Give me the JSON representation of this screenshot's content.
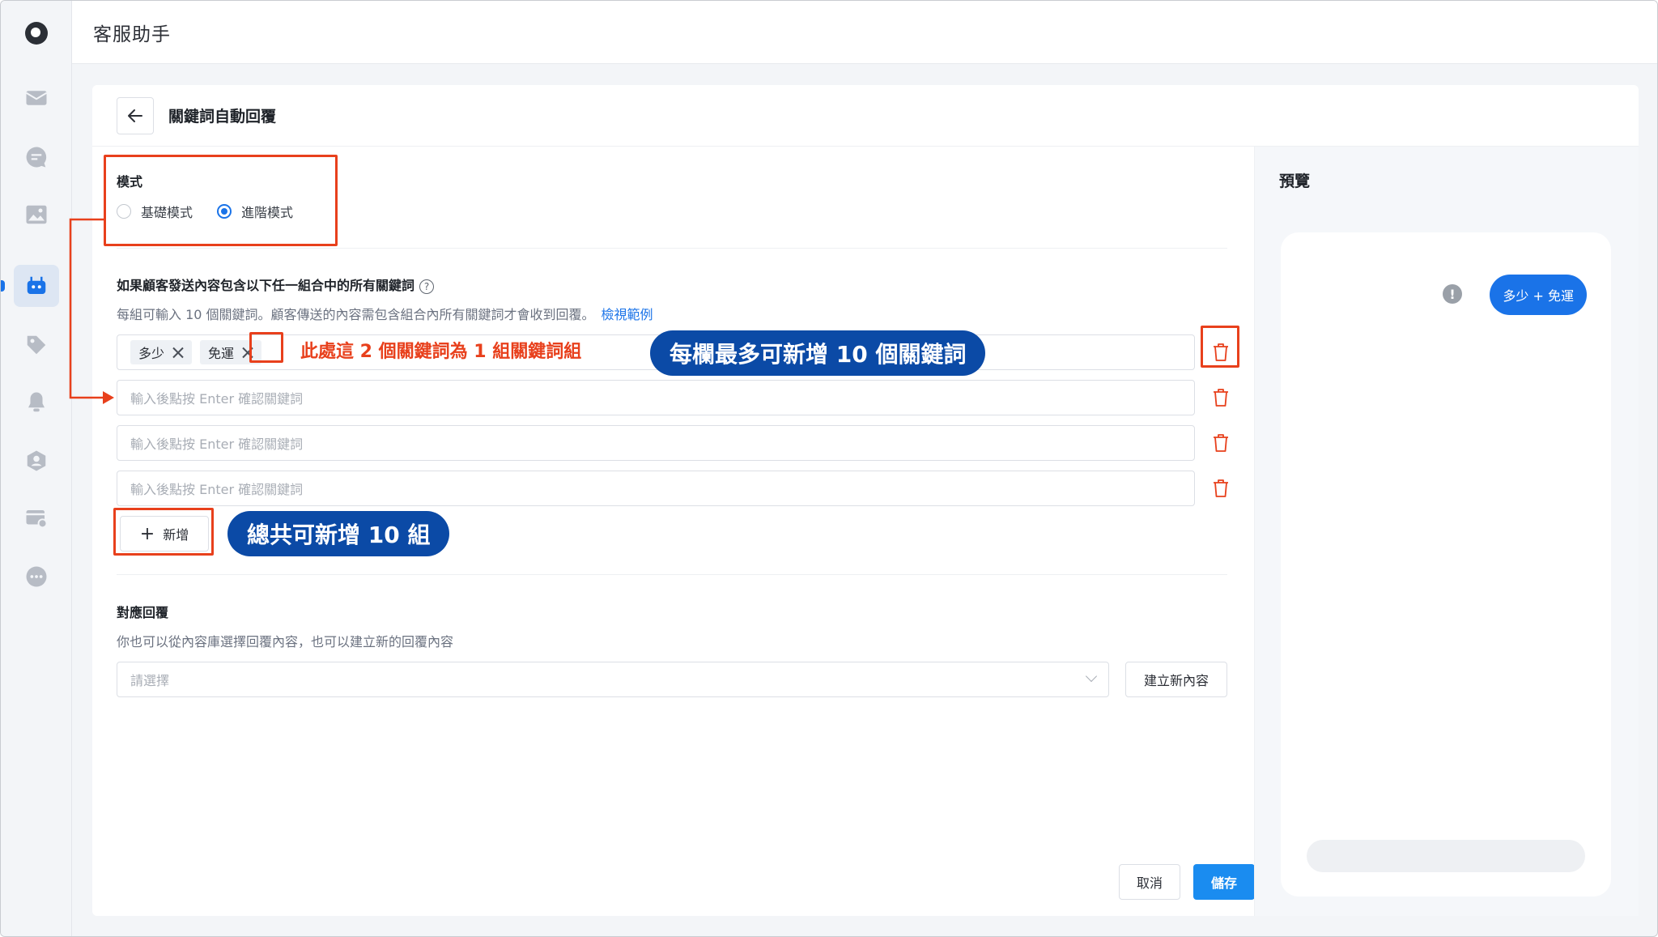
{
  "header": {
    "app_title": "客服助手"
  },
  "page": {
    "title": "關鍵詞自動回覆"
  },
  "mode": {
    "label": "模式",
    "options": [
      {
        "label": "基礎模式",
        "selected": false
      },
      {
        "label": "進階模式",
        "selected": true
      }
    ]
  },
  "keywords": {
    "title": "如果顧客發送內容包含以下任一組合中的所有關鍵詞",
    "hint": "每組可輸入 10 個關鍵詞。顧客傳送的內容需包含組合內所有關鍵詞才會收到回覆。",
    "example_link": "檢視範例",
    "placeholder": "輸入後點按 Enter 確認關鍵詞",
    "groups": [
      {
        "tags": [
          "多少",
          "免運"
        ]
      },
      {
        "tags": []
      },
      {
        "tags": []
      },
      {
        "tags": []
      }
    ],
    "add_label": "新增"
  },
  "reply": {
    "title": "對應回覆",
    "hint": "你也可以從內容庫選擇回覆內容，也可以建立新的回覆內容",
    "select_placeholder": "請選擇",
    "create_label": "建立新內容"
  },
  "footer": {
    "cancel_label": "取消",
    "save_label": "儲存"
  },
  "preview": {
    "title": "預覽",
    "bubble_text": "多少 + 免運",
    "warn_symbol": "!"
  },
  "annotations": {
    "group_note": "此處這 2 個關鍵詞為 1 組關鍵詞組",
    "per_row_note": "每欄最多可新增 10 個關鍵詞",
    "total_note": "總共可新增 10 組"
  },
  "colors": {
    "accent": "#1a73e8",
    "annotation_red": "#e8401c",
    "annotation_blue": "#0b4aa6",
    "delete_red": "#e8401c"
  },
  "icons": {
    "rail": [
      "logo-icon",
      "mail-icon",
      "chat-icon",
      "image-icon",
      "bot-icon",
      "tag-icon",
      "bell-icon",
      "user-shield-icon",
      "card-settings-icon",
      "more-icon"
    ]
  }
}
